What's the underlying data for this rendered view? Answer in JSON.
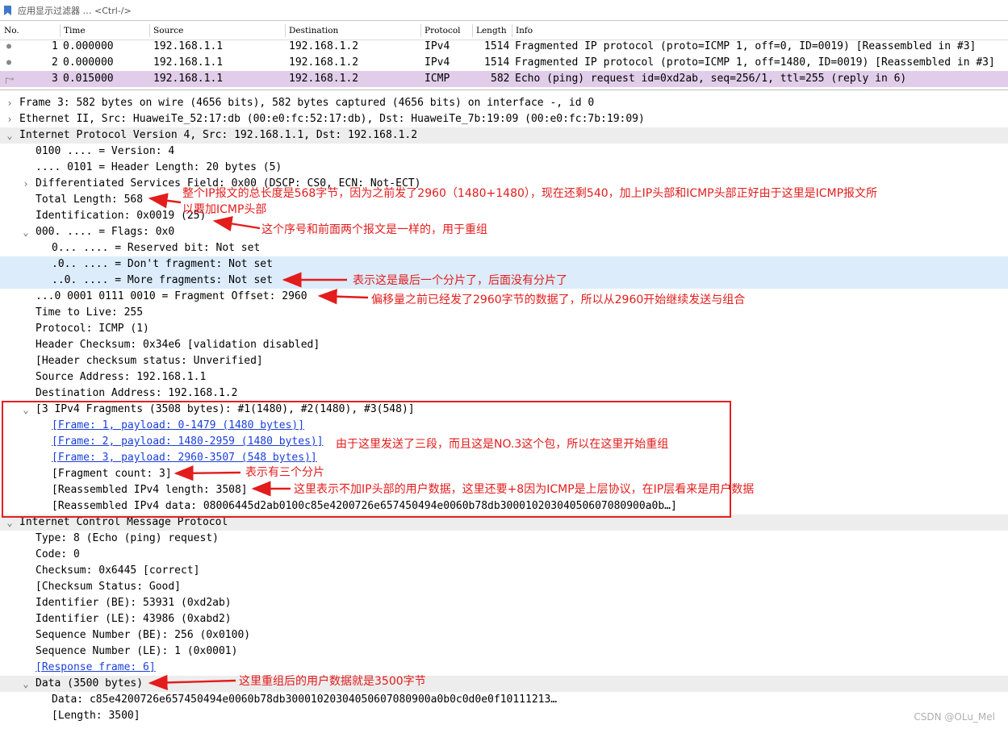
{
  "filter": {
    "placeholder": "应用显示过滤器 … <Ctrl-/>"
  },
  "packet_list": {
    "columns": [
      "No.",
      "Time",
      "Source",
      "Destination",
      "Protocol",
      "Length",
      "Info"
    ],
    "rows": [
      {
        "no": "1",
        "time": "0.000000",
        "src": "192.168.1.1",
        "dst": "192.168.1.2",
        "proto": "IPv4",
        "len": "1514",
        "info": "Fragmented IP protocol (proto=ICMP 1, off=0, ID=0019) [Reassembled in #3]"
      },
      {
        "no": "2",
        "time": "0.000000",
        "src": "192.168.1.1",
        "dst": "192.168.1.2",
        "proto": "IPv4",
        "len": "1514",
        "info": "Fragmented IP protocol (proto=ICMP 1, off=1480, ID=0019) [Reassembled in #3]"
      },
      {
        "no": "3",
        "time": "0.015000",
        "src": "192.168.1.1",
        "dst": "192.168.1.2",
        "proto": "ICMP",
        "len": "582",
        "info": "Echo (ping) request  id=0xd2ab, seq=256/1, ttl=255 (reply in 6)"
      }
    ]
  },
  "tree": {
    "frame": "Frame 3: 582 bytes on wire (4656 bits), 582 bytes captured (4656 bits) on interface -, id 0",
    "ethernet": "Ethernet II, Src: HuaweiTe_52:17:db (00:e0:fc:52:17:db), Dst: HuaweiTe_7b:19:09 (00:e0:fc:7b:19:09)",
    "ipv4": "Internet Protocol Version 4, Src: 192.168.1.1, Dst: 192.168.1.2",
    "ip_version": "0100 .... = Version: 4",
    "ip_hlen": ".... 0101 = Header Length: 20 bytes (5)",
    "ip_dsf": "Differentiated Services Field: 0x00 (DSCP: CS0, ECN: Not-ECT)",
    "ip_total_len": "Total Length: 568",
    "ip_id": "Identification: 0x0019 (25)",
    "ip_flags": "000. .... = Flags: 0x0",
    "flag_reserved": "0... .... = Reserved bit: Not set",
    "flag_df": ".0.. .... = Don't fragment: Not set",
    "flag_mf": "..0. .... = More fragments: Not set",
    "ip_frag_off": "...0 0001 0111 0010 = Fragment Offset: 2960",
    "ip_ttl": "Time to Live: 255",
    "ip_proto": "Protocol: ICMP (1)",
    "ip_cksum": "Header Checksum: 0x34e6 [validation disabled]",
    "ip_cksum_status": "[Header checksum status: Unverified]",
    "ip_src": "Source Address: 192.168.1.1",
    "ip_dst": "Destination Address: 192.168.1.2",
    "frags": "[3 IPv4 Fragments (3508 bytes): #1(1480), #2(1480), #3(548)]",
    "frag1": "[Frame: 1, payload: 0-1479 (1480 bytes)]",
    "frag2": "[Frame: 2, payload: 1480-2959 (1480 bytes)]",
    "frag3": "[Frame: 3, payload: 2960-3507 (548 bytes)]",
    "frag_count": "[Fragment count: 3]",
    "reasm_len": "[Reassembled IPv4 length: 3508]",
    "reasm_data": "[Reassembled IPv4 data: 08006445d2ab0100c85e4200726e657450494e0060b78db30001020304050607080900a0b…]",
    "icmp": "Internet Control Message Protocol",
    "icmp_type": "Type: 8 (Echo (ping) request)",
    "icmp_code": "Code: 0",
    "icmp_cksum": "Checksum: 0x6445 [correct]",
    "icmp_cksum_status": "[Checksum Status: Good]",
    "icmp_id_be": "Identifier (BE): 53931 (0xd2ab)",
    "icmp_id_le": "Identifier (LE): 43986 (0xabd2)",
    "icmp_seq_be": "Sequence Number (BE): 256 (0x0100)",
    "icmp_seq_le": "Sequence Number (LE): 1 (0x0001)",
    "icmp_resp": "[Response frame: 6]",
    "data": "Data (3500 bytes)",
    "data_hex": "Data: c85e4200726e657450494e0060b78db30001020304050607080900a0b0c0d0e0f10111213…",
    "data_len": "[Length: 3500]"
  },
  "annotations": {
    "total_len_line1": "整个IP报文的总长度是568字节，因为之前发了2960（1480+1480），现在还剩540，加上IP头部和ICMP头部正好由于这里是ICMP报文所",
    "total_len_line2": "以要加ICMP头部",
    "identification": "这个序号和前面两个报文是一样的，用于重组",
    "more_fragments": "表示这是最后一个分片了，后面没有分片了",
    "fragment_offset": "偏移量之前已经发了2960字节的数据了，所以从2960开始继续发送与组合",
    "reassembly": "由于这里发送了三段，而且这是NO.3这个包，所以在这里开始重组",
    "fragment_count": "表示有三个分片",
    "reassembled_len": "这里表示不加IP头部的用户数据，这里还要+8因为ICMP是上层协议，在IP层看来是用户数据",
    "data_size": "这里重组后的用户数据就是3500字节"
  },
  "watermark": "CSDN @OLu_Mel",
  "colors": {
    "selected_row": "#e1cde9",
    "highlight_row": "#dcecfb",
    "annotation": "#e31c1c",
    "link": "#1a3fd9"
  }
}
